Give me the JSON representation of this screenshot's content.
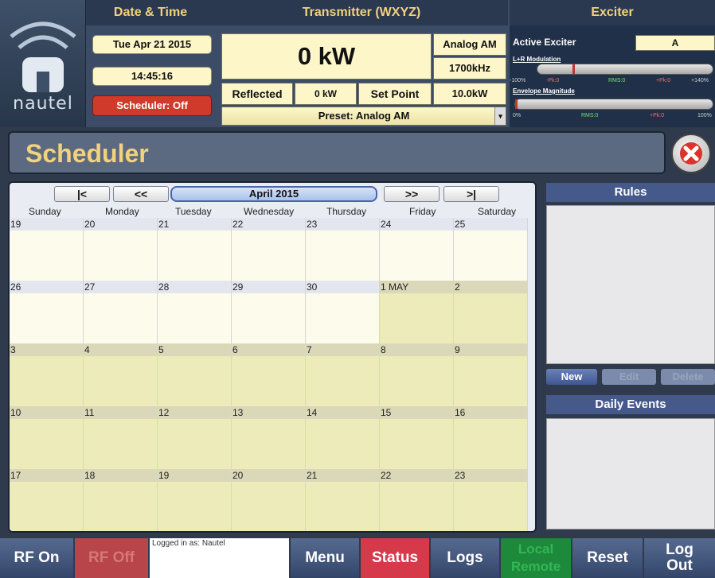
{
  "logo": {
    "text": "nautel"
  },
  "header": {
    "date_time_title": "Date & Time",
    "date": "Tue Apr 21 2015",
    "time": "14:45:16",
    "scheduler_status": "Scheduler: Off",
    "transmitter_title": "Transmitter (WXYZ)",
    "power": "0 kW",
    "mode": "Analog AM",
    "frequency": "1700kHz",
    "reflected_label": "Reflected",
    "reflected_value": "0 kW",
    "setpoint_label": "Set Point",
    "setpoint_value": "10.0kW",
    "preset": "Preset: Analog AM",
    "exciter_title": "Exciter",
    "active_exciter_label": "Active Exciter",
    "active_exciter_value": "A",
    "modulation_label": "L+R Modulation",
    "modulation_scale": {
      "min": "-100%",
      "neg_peak": "-Pk:0",
      "rms": "RMS:0",
      "pos_peak": "+Pk:0",
      "max": "+140%"
    },
    "envelope_label": "Envelope Magnitude",
    "envelope_scale": {
      "min": "0%",
      "rms": "RMS:0",
      "pos_peak": "+Pk:0",
      "max": "100%"
    }
  },
  "page_title": "Scheduler",
  "calendar": {
    "nav": {
      "first": "|<",
      "prev": "<<",
      "month": "April 2015",
      "next": ">>",
      "last": ">|"
    },
    "days": [
      "Sunday",
      "Monday",
      "Tuesday",
      "Wednesday",
      "Thursday",
      "Friday",
      "Saturday"
    ],
    "weeks": [
      [
        "19",
        "20",
        "21",
        "22",
        "23",
        "24",
        "25"
      ],
      [
        "26",
        "27",
        "28",
        "29",
        "30",
        "1 MAY",
        "2"
      ],
      [
        "3",
        "4",
        "5",
        "6",
        "7",
        "8",
        "9"
      ],
      [
        "10",
        "11",
        "12",
        "13",
        "14",
        "15",
        "16"
      ],
      [
        "17",
        "18",
        "19",
        "20",
        "21",
        "22",
        "23"
      ]
    ]
  },
  "rules": {
    "title": "Rules",
    "new": "New",
    "edit": "Edit",
    "delete": "Delete"
  },
  "daily_events": {
    "title": "Daily Events"
  },
  "bottom": {
    "rf_on": "RF On",
    "rf_off": "RF Off",
    "logged_in": "Logged in as: Nautel",
    "menu": "Menu",
    "status": "Status",
    "logs": "Logs",
    "local": "Local",
    "remote": "Remote",
    "reset": "Reset",
    "logout_line1": "Log",
    "logout_line2": "Out"
  },
  "colors": {
    "accent_yellow": "#f2d27c",
    "alarm_red": "#cf3a2a",
    "status_red": "#d6394a",
    "local_green": "#1c8a3a",
    "panel_blue": "#45598b"
  }
}
